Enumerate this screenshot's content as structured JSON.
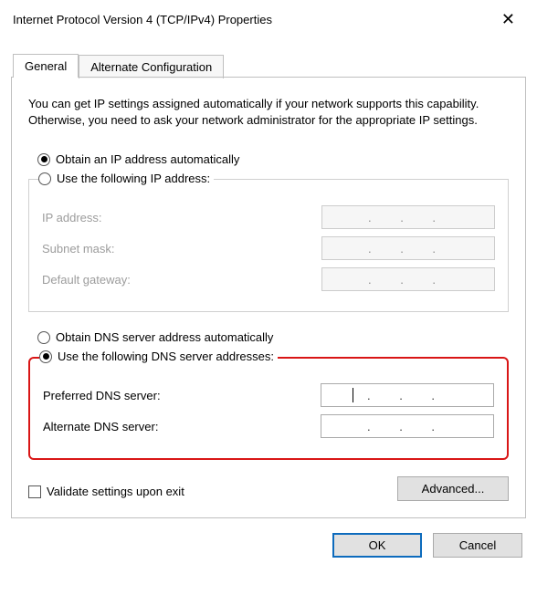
{
  "window": {
    "title": "Internet Protocol Version 4 (TCP/IPv4) Properties"
  },
  "tabs": {
    "general": "General",
    "alternate": "Alternate Configuration"
  },
  "intro": "You can get IP settings assigned automatically if your network supports this capability. Otherwise, you need to ask your network administrator for the appropriate IP settings.",
  "ip": {
    "auto": "Obtain an IP address automatically",
    "manual": "Use the following IP address:",
    "address_label": "IP address:",
    "subnet_label": "Subnet mask:",
    "gateway_label": "Default gateway:",
    "dots": ".   .   ."
  },
  "dns": {
    "auto": "Obtain DNS server address automatically",
    "manual": "Use the following DNS server addresses:",
    "preferred_label": "Preferred DNS server:",
    "alternate_label": "Alternate DNS server:",
    "dots": ".   .   ."
  },
  "validate": "Validate settings upon exit",
  "advanced": "Advanced...",
  "ok": "OK",
  "cancel": "Cancel"
}
